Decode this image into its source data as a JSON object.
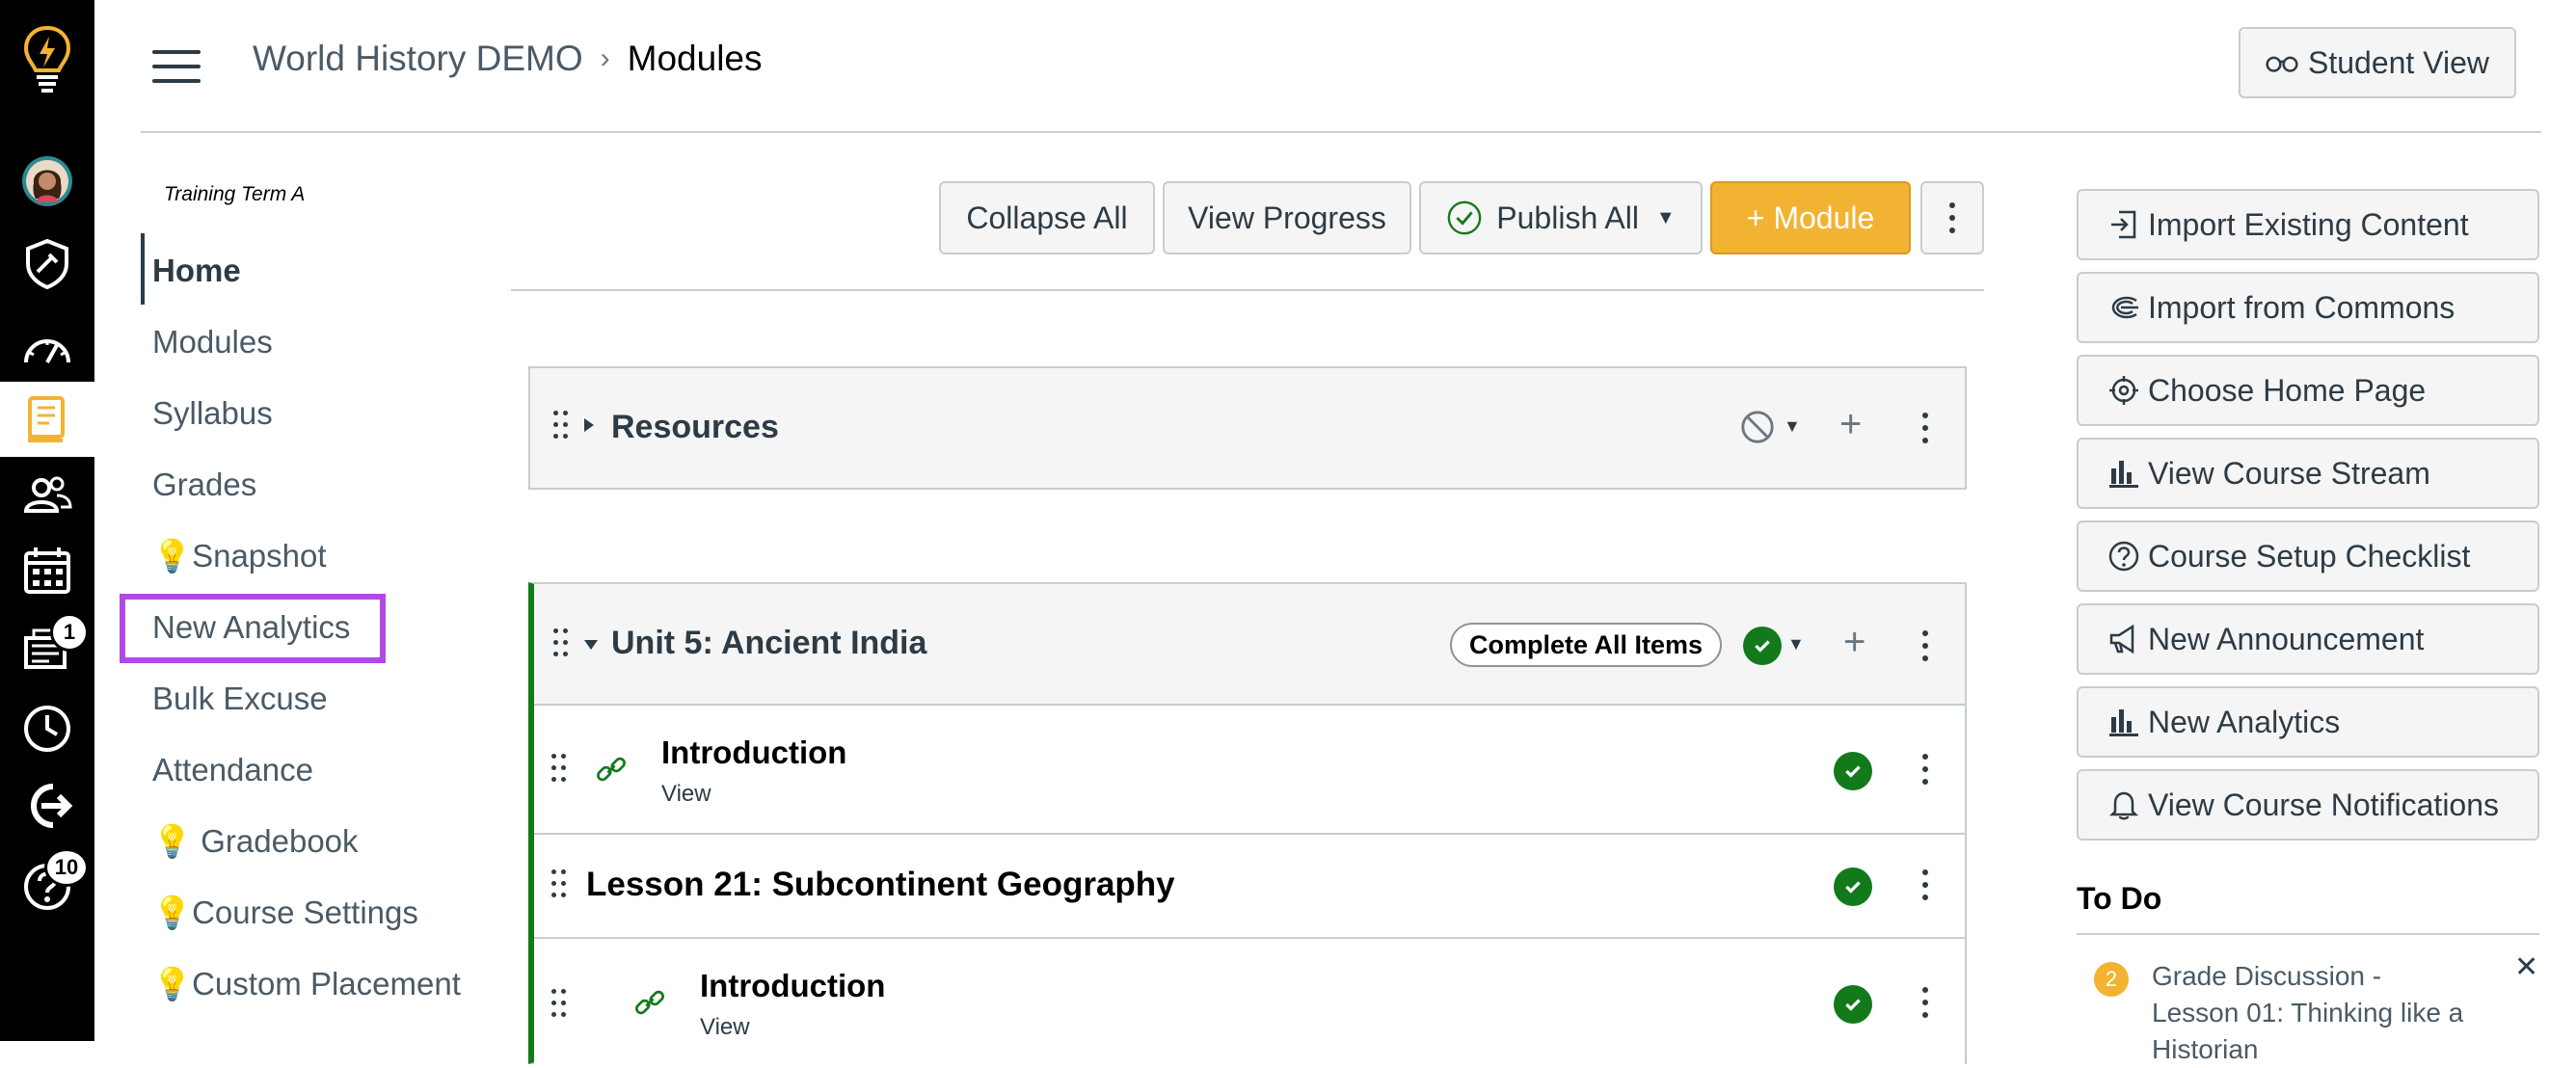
{
  "header": {
    "course": "World History DEMO",
    "separator": "›",
    "page": "Modules",
    "student_view": "Student View"
  },
  "global_nav": {
    "inbox_badge": "1",
    "help_badge": "10"
  },
  "course_nav": {
    "term": "Training Term A",
    "items": [
      {
        "label": "Home"
      },
      {
        "label": "Modules"
      },
      {
        "label": "Syllabus"
      },
      {
        "label": "Grades"
      },
      {
        "label": "💡Snapshot"
      },
      {
        "label": "New Analytics"
      },
      {
        "label": "Bulk Excuse"
      },
      {
        "label": "Attendance"
      },
      {
        "label": "💡 Gradebook"
      },
      {
        "label": "💡Course Settings"
      },
      {
        "label": "💡Custom Placement"
      }
    ]
  },
  "toolbar": {
    "collapse_all": "Collapse All",
    "view_progress": "View Progress",
    "publish_all": "Publish All",
    "add_module": "+ Module"
  },
  "modules": {
    "resources": {
      "title": "Resources"
    },
    "unit5": {
      "title": "Unit 5: Ancient India",
      "requirement": "Complete All Items",
      "items": [
        {
          "title": "Introduction",
          "sub": "View"
        },
        {
          "title": "Lesson 21: Subcontinent Geography"
        },
        {
          "title": "Introduction",
          "sub": "View"
        }
      ]
    }
  },
  "sidebar": {
    "buttons": [
      {
        "label": "Import Existing Content",
        "icon": "import-icon"
      },
      {
        "label": "Import from Commons",
        "icon": "commons-icon"
      },
      {
        "label": "Choose Home Page",
        "icon": "target-icon"
      },
      {
        "label": "View Course Stream",
        "icon": "bar-chart-icon"
      },
      {
        "label": "Course Setup Checklist",
        "icon": "question-icon"
      },
      {
        "label": "New Announcement",
        "icon": "megaphone-icon"
      },
      {
        "label": "New Analytics",
        "icon": "bar-chart-icon"
      },
      {
        "label": "View Course Notifications",
        "icon": "bell-icon"
      }
    ],
    "todo": {
      "heading": "To Do",
      "count": "2",
      "item": "Grade Discussion - Lesson 01: Thinking like a Historian"
    }
  },
  "colors": {
    "accent_yellow": "#f2b332",
    "published_green": "#127a1b",
    "highlight_purple": "#b348e6",
    "global_nav_bg": "#000000"
  }
}
